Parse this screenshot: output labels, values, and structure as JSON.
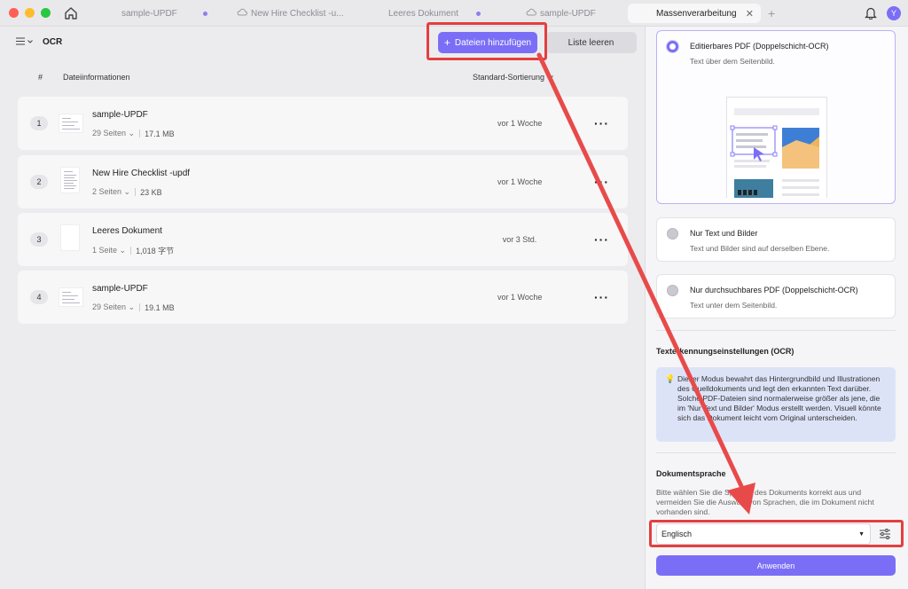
{
  "window": {
    "tabs": [
      {
        "label": "sample-UPDF",
        "cloud": false
      },
      {
        "label": "New Hire Checklist -u...",
        "cloud": true
      },
      {
        "label": "Leeres Dokument",
        "cloud": false
      },
      {
        "label": "sample-UPDF",
        "cloud": true
      },
      {
        "label": "Massenverarbeitung",
        "active": true
      }
    ],
    "avatar_initial": "Y"
  },
  "left": {
    "title": "OCR",
    "add_button": "Dateien hinzufügen",
    "clear_button": "Liste leeren",
    "headers": {
      "num": "#",
      "info": "Dateiinformationen",
      "sort": "Standard-Sortierung"
    },
    "files": [
      {
        "num": "1",
        "name": "sample-UPDF",
        "pages": "29 Seiten",
        "size": "17.1 MB",
        "date": "vor 1 Woche"
      },
      {
        "num": "2",
        "name": "New Hire Checklist -updf",
        "pages": "2 Seiten",
        "size": "23 KB",
        "date": "vor 1 Woche"
      },
      {
        "num": "3",
        "name": "Leeres Dokument",
        "pages": "1 Seite",
        "size": "1,018 字节",
        "date": "vor 3 Std."
      },
      {
        "num": "4",
        "name": "sample-UPDF",
        "pages": "29 Seiten",
        "size": "19.1 MB",
        "date": "vor 1 Woche"
      }
    ]
  },
  "right": {
    "options": [
      {
        "title": "Editierbares PDF (Doppelschicht-OCR)",
        "subtitle": "Text über dem Seitenbild.",
        "selected": true
      },
      {
        "title": "Nur Text und Bilder",
        "subtitle": "Text und Bilder sind auf derselben Ebene.",
        "selected": false
      },
      {
        "title": "Nur durchsuchbares PDF (Doppelschicht-OCR)",
        "subtitle": "Text unter dem Seitenbild.",
        "selected": false
      }
    ],
    "ocr_settings_label": "Texterkennungseinstellungen (OCR)",
    "info_text": "Dieser Modus bewahrt das Hintergrundbild und Illustrationen des Quelldokuments und legt den erkannten Text darüber. Solche PDF-Dateien sind normalerweise größer als jene, die im 'Nur Text und Bilder' Modus erstellt werden. Visuell könnte sich das Dokument leicht vom Original unterscheiden.",
    "language_label": "Dokumentsprache",
    "language_hint": "Bitte wählen Sie die Sprache des Dokuments korrekt aus und vermeiden Sie die Auswahl von Sprachen, die im Dokument nicht vorhanden sind.",
    "language_value": "Englisch",
    "apply_button": "Anwenden"
  },
  "colors": {
    "accent": "#7b6ef6",
    "highlight": "#e43f3f"
  }
}
